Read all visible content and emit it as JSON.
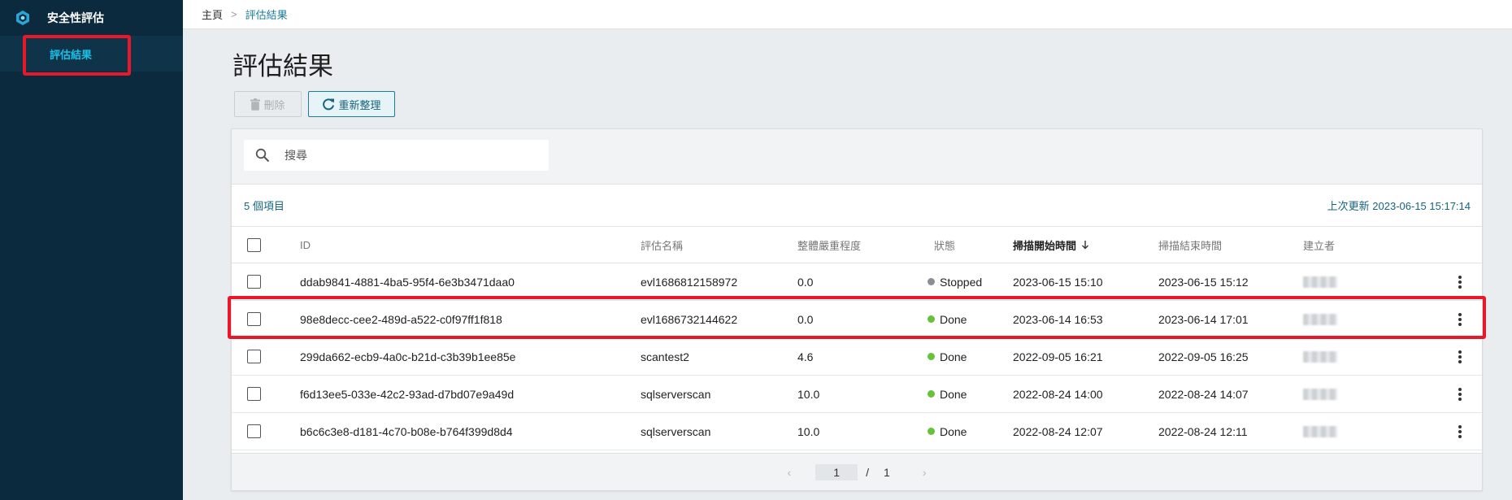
{
  "sidebar": {
    "title": "安全性評估",
    "logo_icon": "hexagon-logo-icon",
    "items": [
      {
        "label": "評估結果",
        "active": true
      }
    ]
  },
  "breadcrumb": {
    "home": "主頁",
    "separator": ">",
    "current": "評估結果"
  },
  "page": {
    "title": "評估結果"
  },
  "toolbar": {
    "delete_label": "刪除",
    "refresh_label": "重新整理"
  },
  "search": {
    "placeholder": "搜尋"
  },
  "summary": {
    "count_label": "5 個項目",
    "last_updated": "上次更新 2023-06-15 15:17:14"
  },
  "table": {
    "columns": {
      "id": "ID",
      "name": "評估名稱",
      "severity": "整體嚴重程度",
      "status": "狀態",
      "start": "掃描開始時間",
      "end": "掃描結束時間",
      "creator": "建立者"
    },
    "sort": {
      "column": "start",
      "direction": "desc"
    },
    "rows": [
      {
        "id": "ddab9841-4881-4ba5-95f4-6e3b3471daa0",
        "name": "evl1686812158972",
        "severity": "0.0",
        "status": "Stopped",
        "status_color": "#8a8f94",
        "start": "2023-06-15 15:10",
        "end": "2023-06-15 15:12"
      },
      {
        "id": "98e8decc-cee2-489d-a522-c0f97ff1f818",
        "name": "evl1686732144622",
        "severity": "0.0",
        "status": "Done",
        "status_color": "#67c23a",
        "start": "2023-06-14 16:53",
        "end": "2023-06-14 17:01"
      },
      {
        "id": "299da662-ecb9-4a0c-b21d-c3b39b1ee85e",
        "name": "scantest2",
        "severity": "4.6",
        "status": "Done",
        "status_color": "#67c23a",
        "start": "2022-09-05 16:21",
        "end": "2022-09-05 16:25"
      },
      {
        "id": "f6d13ee5-033e-42c2-93ad-d7bd07e9a49d",
        "name": "sqlserverscan",
        "severity": "10.0",
        "status": "Done",
        "status_color": "#67c23a",
        "start": "2022-08-24 14:00",
        "end": "2022-08-24 14:07"
      },
      {
        "id": "b6c6c3e8-d181-4c70-b08e-b764f399d8d4",
        "name": "sqlserverscan",
        "severity": "10.0",
        "status": "Done",
        "status_color": "#67c23a",
        "start": "2022-08-24 12:07",
        "end": "2022-08-24 12:11"
      }
    ]
  },
  "pagination": {
    "current": "1",
    "separator": "/",
    "total": "1",
    "prev_icon": "chevron-left-icon",
    "next_icon": "chevron-right-icon"
  },
  "colors": {
    "accent": "#1a7c9a",
    "sidebar_bg": "#0c2a3e",
    "highlight": "#e8182a"
  }
}
